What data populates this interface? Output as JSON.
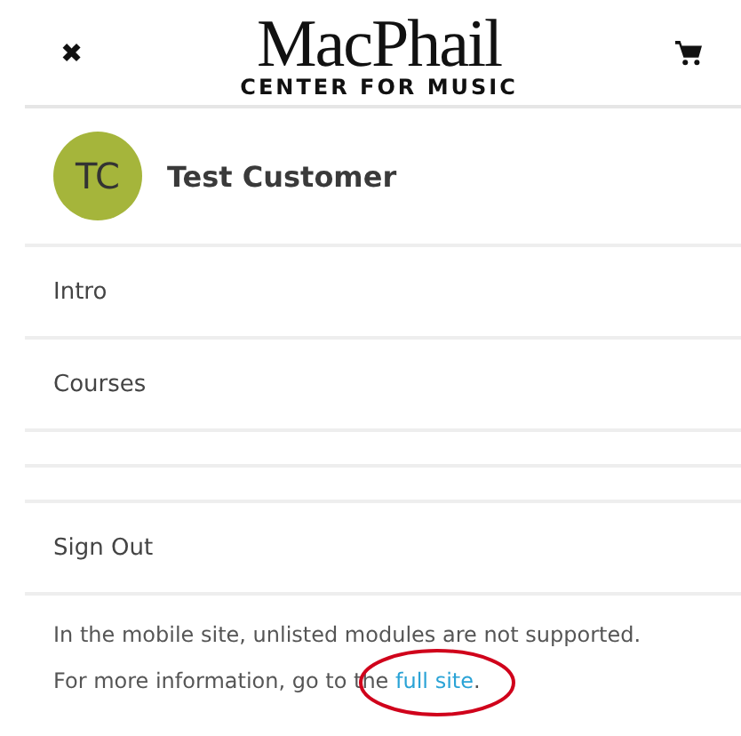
{
  "header": {
    "close": "✖",
    "logo": {
      "name": "MacPhail",
      "tagline": "CENTER FOR MUSIC"
    }
  },
  "profile": {
    "initials": "TC",
    "name": "Test Customer"
  },
  "menu": [
    {
      "kind": "link",
      "label": "Intro"
    },
    {
      "kind": "link",
      "label": "Courses"
    },
    {
      "kind": "blank"
    },
    {
      "kind": "blank"
    },
    {
      "kind": "link",
      "label": "Sign Out"
    }
  ],
  "notice": {
    "line_1": "In the mobile site, unlisted modules are not supported.",
    "line_2": "For more information, go to the ",
    "link": "full site",
    "end": ".",
    "link_circled": true
  }
}
